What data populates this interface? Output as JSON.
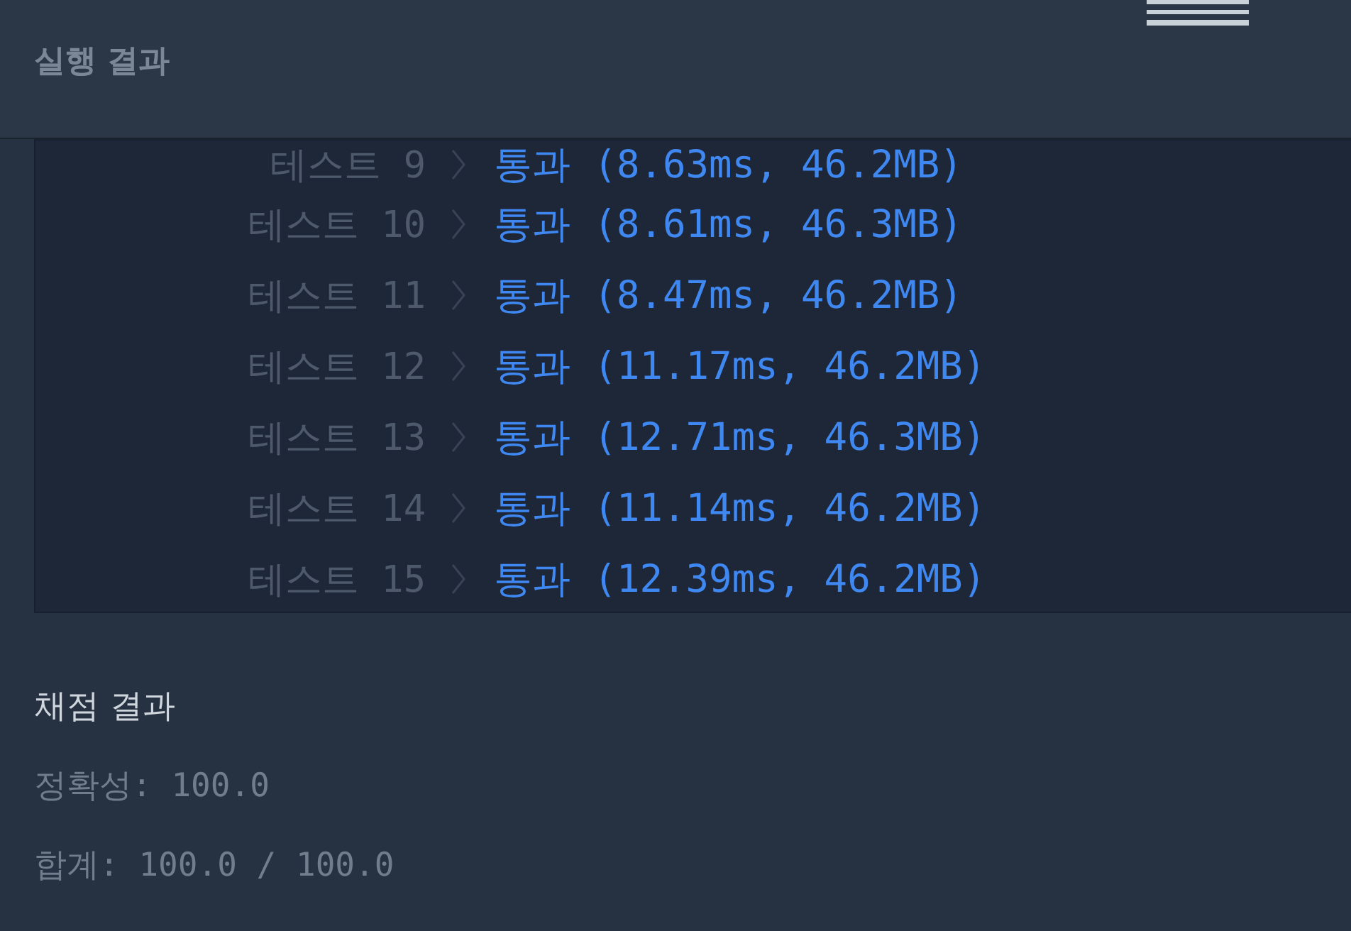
{
  "header": {
    "title": "실행 결과"
  },
  "console": {
    "rows": [
      {
        "label": "테스트 9",
        "result": "통과 (8.63ms, 46.2MB)"
      },
      {
        "label": "테스트 10",
        "result": "통과 (8.61ms, 46.3MB)"
      },
      {
        "label": "테스트 11",
        "result": "통과 (8.47ms, 46.2MB)"
      },
      {
        "label": "테스트 12",
        "result": "통과 (11.17ms, 46.2MB)"
      },
      {
        "label": "테스트 13",
        "result": "통과 (12.71ms, 46.3MB)"
      },
      {
        "label": "테스트 14",
        "result": "통과 (11.14ms, 46.2MB)"
      },
      {
        "label": "테스트 15",
        "result": "통과 (12.39ms, 46.2MB)"
      }
    ]
  },
  "grading": {
    "title": "채점 결과",
    "lines": [
      "정확성: 100.0",
      "합계: 100.0 / 100.0"
    ]
  }
}
